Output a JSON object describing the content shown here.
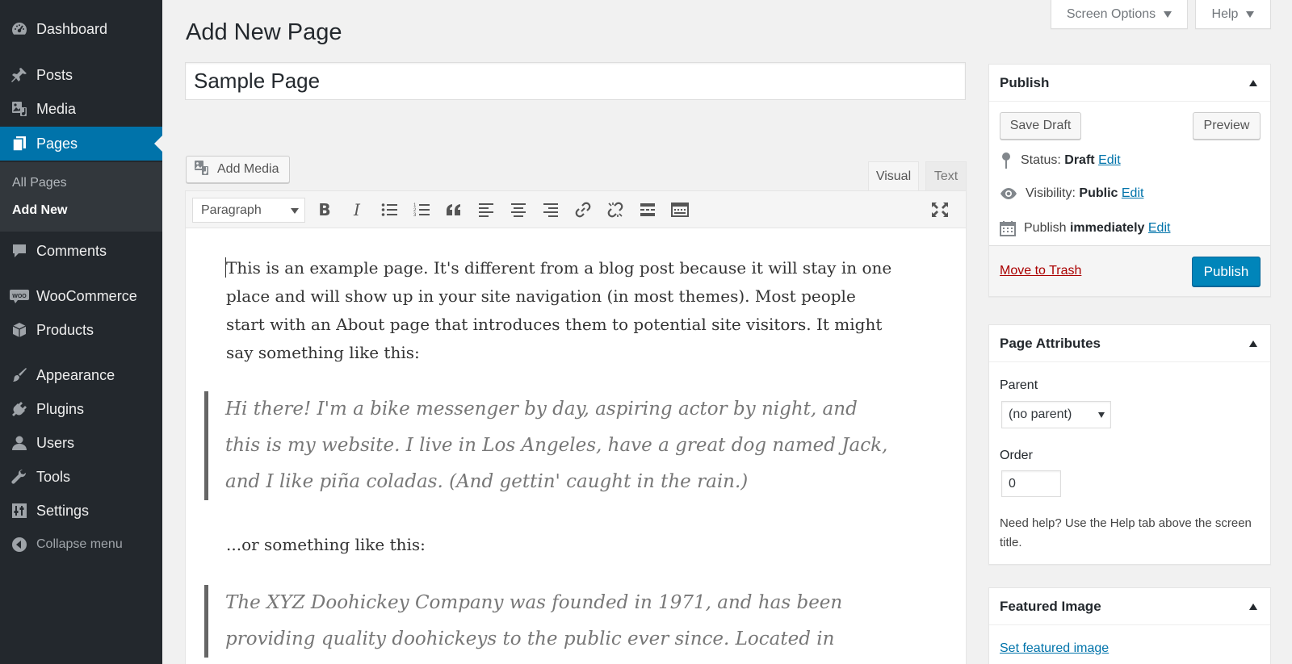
{
  "sidebar": {
    "items": [
      {
        "label": "Dashboard",
        "icon": "dashboard-icon"
      },
      {
        "label": "Posts",
        "icon": "pushpin-icon"
      },
      {
        "label": "Media",
        "icon": "media-icon"
      },
      {
        "label": "Pages",
        "icon": "pages-icon"
      },
      {
        "label": "Comments",
        "icon": "comment-icon"
      },
      {
        "label": "WooCommerce",
        "icon": "woocommerce-icon"
      },
      {
        "label": "Products",
        "icon": "products-box-icon"
      },
      {
        "label": "Appearance",
        "icon": "paintbrush-icon"
      },
      {
        "label": "Plugins",
        "icon": "plugin-icon"
      },
      {
        "label": "Users",
        "icon": "user-icon"
      },
      {
        "label": "Tools",
        "icon": "wrench-icon"
      },
      {
        "label": "Settings",
        "icon": "settings-sliders-icon"
      }
    ],
    "current": "Pages",
    "submenu": [
      "All Pages",
      "Add New"
    ],
    "submenu_current": "Add New",
    "collapse_label": "Collapse menu",
    "accent_color": "#0073aa",
    "background_color": "#23282d"
  },
  "top_buttons": {
    "screen_options": "Screen Options",
    "help": "Help"
  },
  "page_title": "Add New Page",
  "title_field": {
    "value": "Sample Page"
  },
  "add_media_label": "Add Media",
  "editor_tabs": {
    "visual": "Visual",
    "text": "Text",
    "active": "Visual"
  },
  "toolbar": {
    "format_value": "Paragraph",
    "buttons": [
      "bold-icon",
      "italic-icon",
      "bulleted-list-icon",
      "numbered-list-icon",
      "blockquote-icon",
      "align-left-icon",
      "align-center-icon",
      "align-right-icon",
      "insert-link-icon",
      "remove-link-icon",
      "read-more-icon",
      "toolbar-toggle-icon"
    ],
    "fullscreen_icon": "fullscreen-icon"
  },
  "content": {
    "paragraph_1": "This is an example page. It's different from a blog post because it will stay in one place and will show up in your site navigation (in most themes). Most people start with an About page that introduces them to potential site visitors. It might say something like this:",
    "quote_1": "Hi there! I'm a bike messenger by day, aspiring actor by night, and this is my website. I live in Los Angeles, have a great dog named Jack, and I like piña coladas. (And gettin' caught in the rain.)",
    "paragraph_2": "...or something like this:",
    "quote_2": "The XYZ Doohickey Company was founded in 1971, and has been providing quality doohickeys to the public ever since. Located in"
  },
  "publish_box": {
    "title": "Publish",
    "save_draft": "Save Draft",
    "preview": "Preview",
    "status_label": "Status:",
    "status_value": "Draft",
    "visibility_label": "Visibility:",
    "visibility_value": "Public",
    "publish_label": "Publish",
    "publish_value": "immediately",
    "edit_label": "Edit",
    "trash_label": "Move to Trash",
    "publish_button": "Publish",
    "publish_color": "#0085ba"
  },
  "page_attributes": {
    "title": "Page Attributes",
    "parent_label": "Parent",
    "parent_value": "(no parent)",
    "order_label": "Order",
    "order_value": "0",
    "help_text": "Need help? Use the Help tab above the screen title."
  },
  "featured_image": {
    "title": "Featured Image",
    "link": "Set featured image"
  }
}
